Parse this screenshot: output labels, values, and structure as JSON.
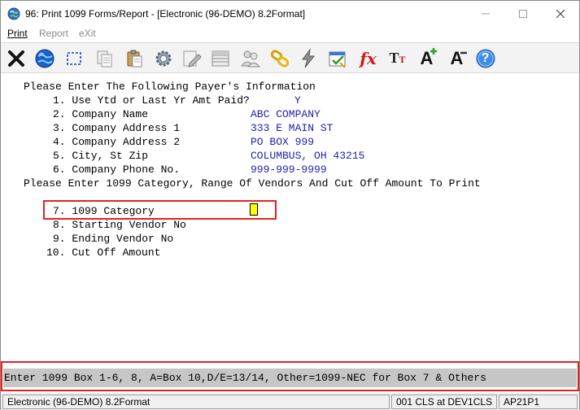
{
  "window": {
    "title": "96: Print 1099 Forms/Report - [Electronic (96-DEMO) 8.2Format]"
  },
  "menu": {
    "print": "Print",
    "report": "Report",
    "exit": "eXit"
  },
  "toolbar": {
    "buttons": [
      "close-x-icon",
      "globe-icon",
      "select-rectangle-icon",
      "copy-icon",
      "paste-icon",
      "settings-gear-icon",
      "edit-pencil-icon",
      "grid-list-icon",
      "users-icon",
      "chain-link-icon",
      "lightning-icon",
      "calendar-check-icon",
      "function-fx-icon",
      "font-size-icon",
      "increase-font-icon",
      "decrease-font-icon",
      "help-question-icon"
    ],
    "fx_glyph": "fx",
    "font_glyph_big": "T",
    "font_glyph_small": "T",
    "grow_glyph": "A",
    "shrink_glyph": "A",
    "help_glyph": "?"
  },
  "form": {
    "header_payer": "Please Enter The Following Payer's Information",
    "fields": [
      {
        "label": "1. Use Ytd or Last Yr Amt Paid?",
        "value": "Y"
      },
      {
        "label": "2. Company Name",
        "value": "ABC COMPANY"
      },
      {
        "label": "3. Company Address 1",
        "value": "333 E MAIN ST"
      },
      {
        "label": "4. Company Address 2",
        "value": "PO BOX 999"
      },
      {
        "label": "5. City, St Zip",
        "value": "COLUMBUS, OH 43215"
      },
      {
        "label": "6. Company Phone No.",
        "value": "999-999-9999"
      }
    ],
    "header_category": "Please Enter 1099 Category, Range Of Vendors And Cut Off Amount To Print",
    "category_fields": [
      {
        "label": "7. 1099 Category",
        "value": ""
      },
      {
        "label": "8. Starting Vendor No",
        "value": ""
      },
      {
        "label": "9. Ending Vendor No",
        "value": ""
      },
      {
        "label": "10. Cut Off Amount",
        "value": ""
      }
    ]
  },
  "help": {
    "text": "Enter 1099 Box 1-6, 8, A=Box 10,D/E=13/14, Other=1099-NEC for Box 7 & Others"
  },
  "status": {
    "format": "Electronic (96-DEMO) 8.2Format",
    "session": "001 CLS at DEV1CLS",
    "program": "AP21P1"
  },
  "colors": {
    "value_text": "#1f1fae",
    "highlight_box": "#e2241f",
    "cursor": "#ffff00"
  }
}
